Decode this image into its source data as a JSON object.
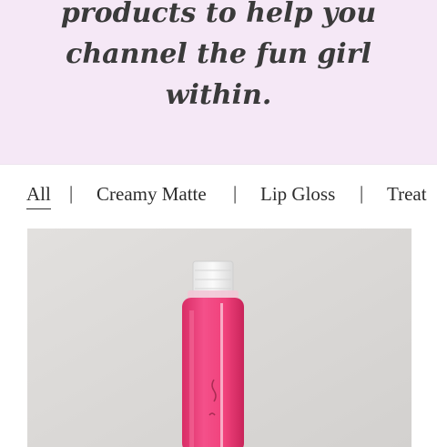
{
  "hero": {
    "lines": [
      "products to help you",
      "channel the fun girl",
      "within."
    ]
  },
  "filters": [
    {
      "label": "All",
      "active": true
    },
    {
      "label": "Creamy Matte",
      "active": false
    },
    {
      "label": "Lip Gloss",
      "active": false
    },
    {
      "label": "Treat",
      "active": false
    }
  ],
  "separator": "|",
  "product": {
    "image": "pink-lip-gloss-tube",
    "colors": {
      "background": "#dcdad8",
      "gloss": "#f0407a",
      "cap": "#f2f2f2"
    }
  },
  "colors": {
    "hero_background": "#f5e8f6",
    "text": "#3a3a3a"
  }
}
